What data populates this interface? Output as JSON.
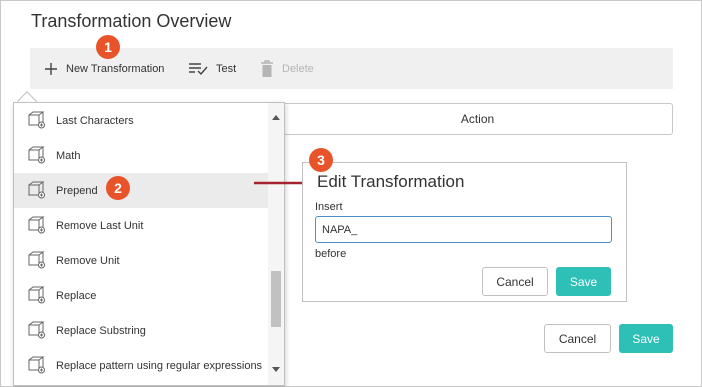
{
  "page": {
    "title": "Transformation Overview"
  },
  "toolbar": {
    "new_label": "New Transformation",
    "test_label": "Test",
    "delete_label": "Delete"
  },
  "badges": {
    "one": "1",
    "two": "2",
    "three": "3"
  },
  "table": {
    "action_header": "Action"
  },
  "dropdown": {
    "items": [
      {
        "label": "Last Characters",
        "icon": "transform-cube-icon"
      },
      {
        "label": "Math",
        "icon": "transform-cube-icon"
      },
      {
        "label": "Prepend",
        "icon": "transform-cube-icon",
        "selected": true
      },
      {
        "label": "Remove Last Unit",
        "icon": "transform-cube-icon"
      },
      {
        "label": "Remove Unit",
        "icon": "transform-cube-icon"
      },
      {
        "label": "Replace",
        "icon": "transform-cube-icon"
      },
      {
        "label": "Replace Substring",
        "icon": "transform-cube-icon"
      },
      {
        "label": "Replace pattern using regular expressions",
        "icon": "transform-cube-icon"
      }
    ]
  },
  "edit": {
    "title": "Edit Transformation",
    "insert_label": "Insert",
    "insert_value": "NAPA_",
    "before_label": "before",
    "cancel_label": "Cancel",
    "save_label": "Save"
  },
  "footer": {
    "cancel_label": "Cancel",
    "save_label": "Save"
  },
  "colors": {
    "accent": "#2ebfb6",
    "badge": "#e8532a",
    "arrow": "#a5232c",
    "input_border": "#4a90c2"
  }
}
